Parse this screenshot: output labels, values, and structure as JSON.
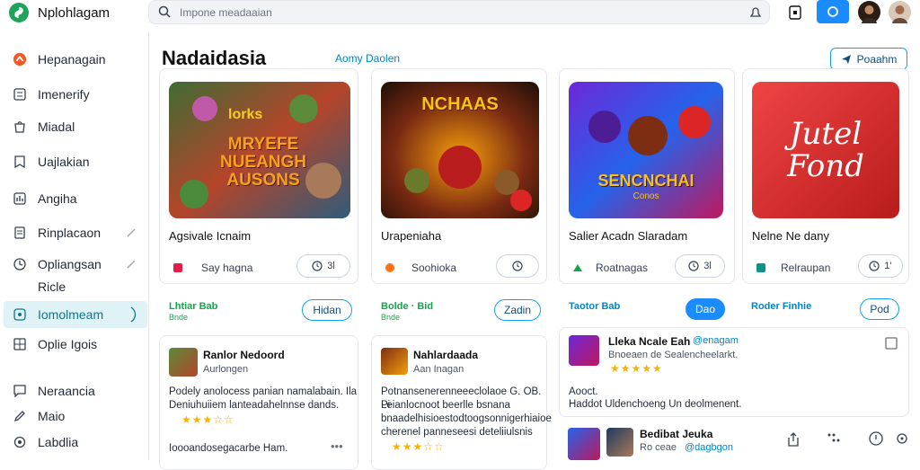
{
  "app": {
    "brand": "Nplohlagam"
  },
  "search": {
    "placeholder": "Impone meadaaian"
  },
  "sidebar": {
    "items": [
      {
        "label": "Hepanagain",
        "icon": "home-icon"
      },
      {
        "label": "Imenerify",
        "icon": "identity-icon"
      },
      {
        "label": "Miadal",
        "icon": "bag-icon"
      },
      {
        "label": "Uajlakian",
        "icon": "bookmark-icon"
      },
      {
        "label": "Angiha",
        "icon": "chart-icon"
      },
      {
        "label": "Rinplacaon",
        "icon": "document-icon"
      },
      {
        "label": "Opliangsan",
        "icon": "clock-icon"
      },
      {
        "label": "Ricle",
        "icon": ""
      },
      {
        "label": "Iomolmeam",
        "icon": "shield-icon",
        "active": true
      },
      {
        "label": "Oplie Igois",
        "icon": "grid-icon"
      },
      {
        "label": "Neraancia",
        "icon": "message-icon"
      },
      {
        "label": "Maio",
        "icon": "pencil-icon"
      },
      {
        "label": "Labdlia",
        "icon": "settings-icon"
      }
    ]
  },
  "main": {
    "title": "Nadaidasia",
    "subtitle_link": "Aomy Daolen",
    "top_button": "Poaahm"
  },
  "cards": [
    {
      "title": "Agsivale Icnaim",
      "meta": "Say hagna",
      "pill": "3l",
      "tag": "Lhtiar Bab",
      "tag_sub": "Bnde",
      "button": "Hidan",
      "art_text": "MRYEFE NUEANGH AUSONS",
      "art_top": "lorks"
    },
    {
      "title": "Urapeniaha",
      "meta": "Soohioka",
      "pill": "",
      "tag": "Bolde · Bid",
      "tag_sub": "Bnde",
      "button": "Zadin",
      "art_text": "NCHAAS",
      "art_top": ""
    },
    {
      "title": "Salier Acadn Slaradam",
      "meta": "Roatnagas",
      "pill": "3l",
      "tag": "Taotor Bab",
      "tag_sub": "",
      "button": "Dao",
      "art_text": "SENCNCHAI",
      "art_top": "Conos"
    },
    {
      "title": "Nelne Ne dany",
      "meta": "Relraupan",
      "pill": "1'",
      "tag": "Roder Finhie",
      "tag_sub": "",
      "button": "Pod",
      "art_text": "Jutel Fond",
      "art_top": ""
    }
  ],
  "reviews": [
    {
      "name": "Ranlor Nedoord",
      "sub": "Aurlongen",
      "body1": "Podely anolocess panian namalabain. Ila",
      "body2": "Deniuhuiiem lanteadahelnnse dands.",
      "footer": "Ioooandosegacarbe Ham."
    },
    {
      "name": "Nahlardaada",
      "sub": "Aan Inagan",
      "body1": "Potnansenerenneeeclolaoe G. OB. Pi",
      "body2": "Leianlocnoot beerlle bsnana",
      "body3": "bnaadelhisioestodtoogsonnigerhiaioe",
      "body4": "cherenel panneseesi deteliiulsnis"
    },
    {
      "name": "Lleka Ncale Eah",
      "handle": "@enagam",
      "sub": "Bnoeaen de Sealencheelarkt.",
      "footer1": "Aooct.",
      "footer2": "Haddot Uldenchoeng Un deolmenent."
    },
    {
      "name": "Bedibat Jeuka",
      "sub": "Ro ceae",
      "handle": "@dagbgon"
    }
  ],
  "colors": {
    "accent": "#0ea5e9",
    "active_bg": "#dff3f6",
    "tag_green": "#16a34a",
    "tag_blue": "#0284c7"
  }
}
